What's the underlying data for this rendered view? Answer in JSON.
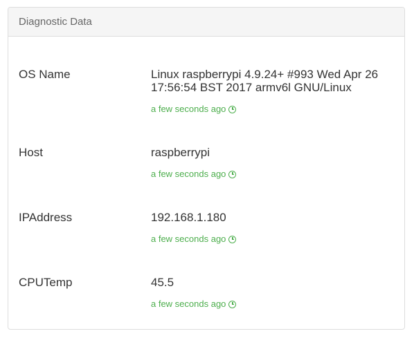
{
  "panel": {
    "title": "Diagnostic Data"
  },
  "rows": [
    {
      "label": "OS Name",
      "value": "Linux raspberrypi 4.9.24+ #993 Wed Apr 26 17:56:54 BST 2017 armv6l GNU/Linux",
      "timestamp": "a few seconds ago",
      "icon": "clock-icon"
    },
    {
      "label": "Host",
      "value": "raspberrypi",
      "timestamp": "a few seconds ago",
      "icon": "clock-icon"
    },
    {
      "label": "IPAddress",
      "value": "192.168.1.180",
      "timestamp": "a few seconds ago",
      "icon": "clock-icon"
    },
    {
      "label": "CPUTemp",
      "value": "45.5",
      "timestamp": "a few seconds ago",
      "icon": "clock-icon"
    }
  ],
  "colors": {
    "timestamp": "#4cae4c",
    "heading_bg": "#f5f5f5",
    "border": "#dddddd"
  }
}
